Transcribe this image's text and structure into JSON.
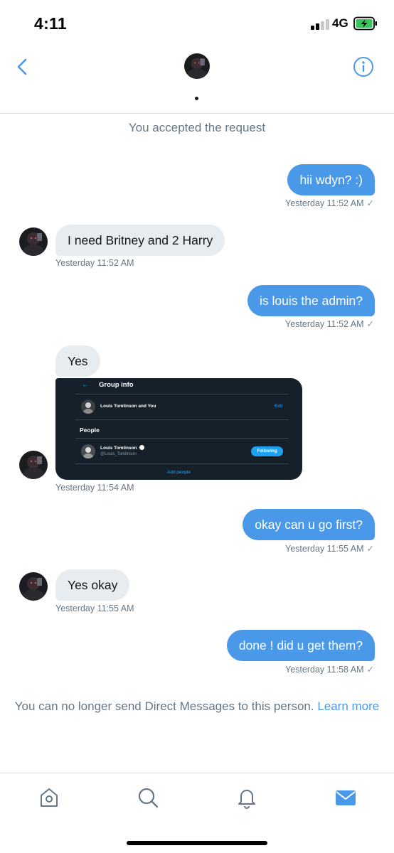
{
  "status_bar": {
    "time": "4:11",
    "network": "4G",
    "battery_color": "#34c759"
  },
  "header": {
    "back_icon": "chevron-left-icon",
    "info_icon": "info-circle-icon",
    "accent_color": "#4a99e9"
  },
  "system_note": "You accepted the request",
  "messages": [
    {
      "direction": "out",
      "text": "hii wdyn? :)",
      "time": "Yesterday 11:52 AM",
      "read_mark": "✓"
    },
    {
      "direction": "in",
      "text": "I need Britney and 2 Harry",
      "time": "Yesterday 11:52 AM"
    },
    {
      "direction": "out",
      "text": "is louis the admin?",
      "time": "Yesterday 11:52 AM",
      "read_mark": "✓"
    },
    {
      "direction": "in",
      "text": "Yes",
      "time": "Yesterday 11:54 AM"
    },
    {
      "direction": "out",
      "text": "okay can u go first?",
      "time": "Yesterday 11:55 AM",
      "read_mark": "✓"
    },
    {
      "direction": "in",
      "text": "Yes okay",
      "time": "Yesterday 11:55 AM"
    },
    {
      "direction": "out",
      "text": "done ! did u get them?",
      "time": "Yesterday 11:58 AM",
      "read_mark": "✓"
    }
  ],
  "attachment": {
    "back": "←",
    "title": "Group info",
    "group_name": "Louis Tomlinson and You",
    "edit": "Edit",
    "section": "People",
    "member_name": "Louis Tomlinson",
    "member_handle": "@Louis_Tomlinson",
    "follow_button": "Following",
    "add_people": "Add people"
  },
  "notice": {
    "text": "You can no longer send Direct Messages to this person.",
    "link": "Learn more"
  },
  "tabs": [
    {
      "name": "home",
      "icon": "home-icon",
      "active": false
    },
    {
      "name": "search",
      "icon": "search-icon",
      "active": false
    },
    {
      "name": "notifications",
      "icon": "bell-icon",
      "active": false
    },
    {
      "name": "messages",
      "icon": "mail-icon",
      "active": true
    }
  ]
}
